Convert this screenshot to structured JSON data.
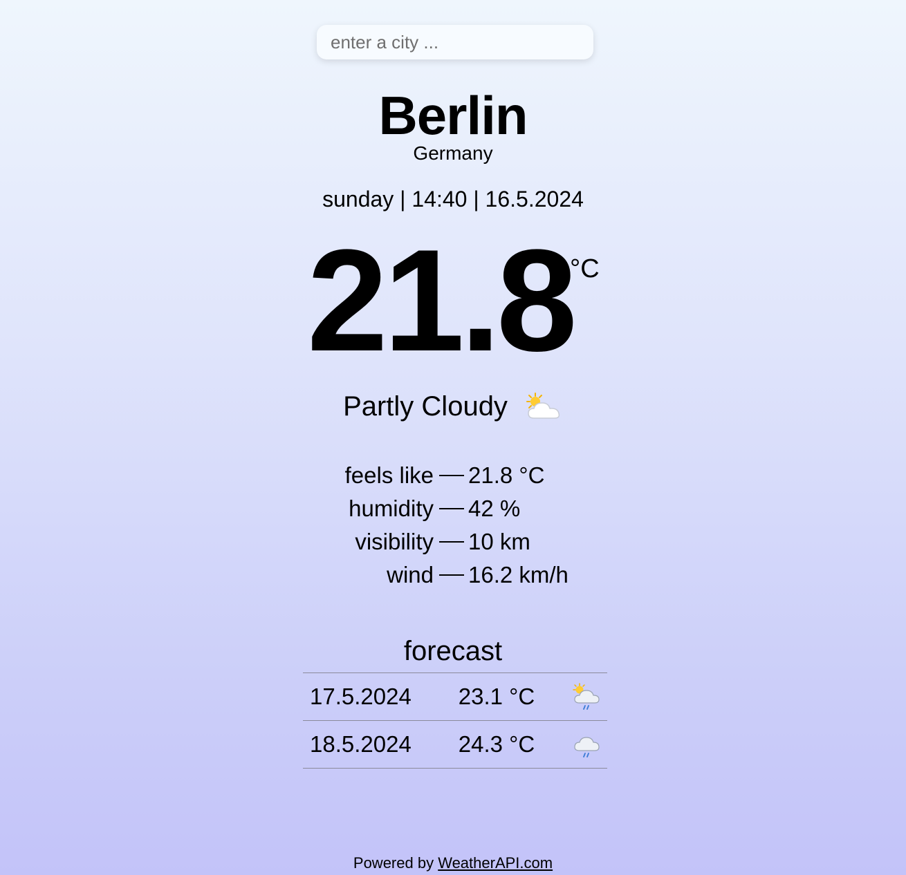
{
  "search": {
    "placeholder": "enter a city ...",
    "value": ""
  },
  "location": {
    "city": "Berlin",
    "country": "Germany"
  },
  "datetime": "sunday | 14:40 | 16.5.2024",
  "current": {
    "temperature": "21.8",
    "unit": "°C",
    "condition": "Partly Cloudy",
    "condition_icon": "partly-cloudy-icon"
  },
  "details": [
    {
      "label": "feels like",
      "value": "21.8 °C"
    },
    {
      "label": "humidity",
      "value": "42 %"
    },
    {
      "label": "visibility",
      "value": "10 km"
    },
    {
      "label": "wind",
      "value": "16.2 km/h"
    }
  ],
  "forecast": {
    "title": "forecast",
    "days": [
      {
        "date": "17.5.2024",
        "temp": "23.1 °C",
        "icon": "sun-cloud-rain-icon"
      },
      {
        "date": "18.5.2024",
        "temp": "24.3 °C",
        "icon": "cloud-rain-icon"
      }
    ]
  },
  "footer": {
    "prefix": "Powered by",
    "link_text": "WeatherAPI.com"
  },
  "colors": {
    "background_top": "#eff6fd",
    "background_bottom": "#c3c3f9",
    "text": "#000000"
  }
}
